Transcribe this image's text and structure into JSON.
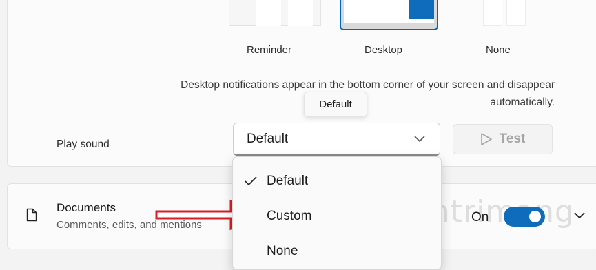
{
  "notification_styles": {
    "options": [
      {
        "label": "Reminder"
      },
      {
        "label": "Desktop",
        "selected": true
      },
      {
        "label": "None"
      }
    ],
    "description": "Desktop notifications appear in the bottom corner of your screen and disappear automatically."
  },
  "play_sound": {
    "label": "Play sound",
    "selected_value": "Default",
    "tooltip": "Default",
    "test_label": "Test",
    "menu": [
      {
        "label": "Default",
        "checked": true
      },
      {
        "label": "Custom"
      },
      {
        "label": "None"
      }
    ]
  },
  "documents": {
    "title": "Documents",
    "subtitle": "Comments, edits, and mentions",
    "toggle_label": "On",
    "toggle_state": true
  },
  "watermark": "uantrimang",
  "colors": {
    "accent": "#0f6cbd",
    "arrow": "#d4202a"
  }
}
